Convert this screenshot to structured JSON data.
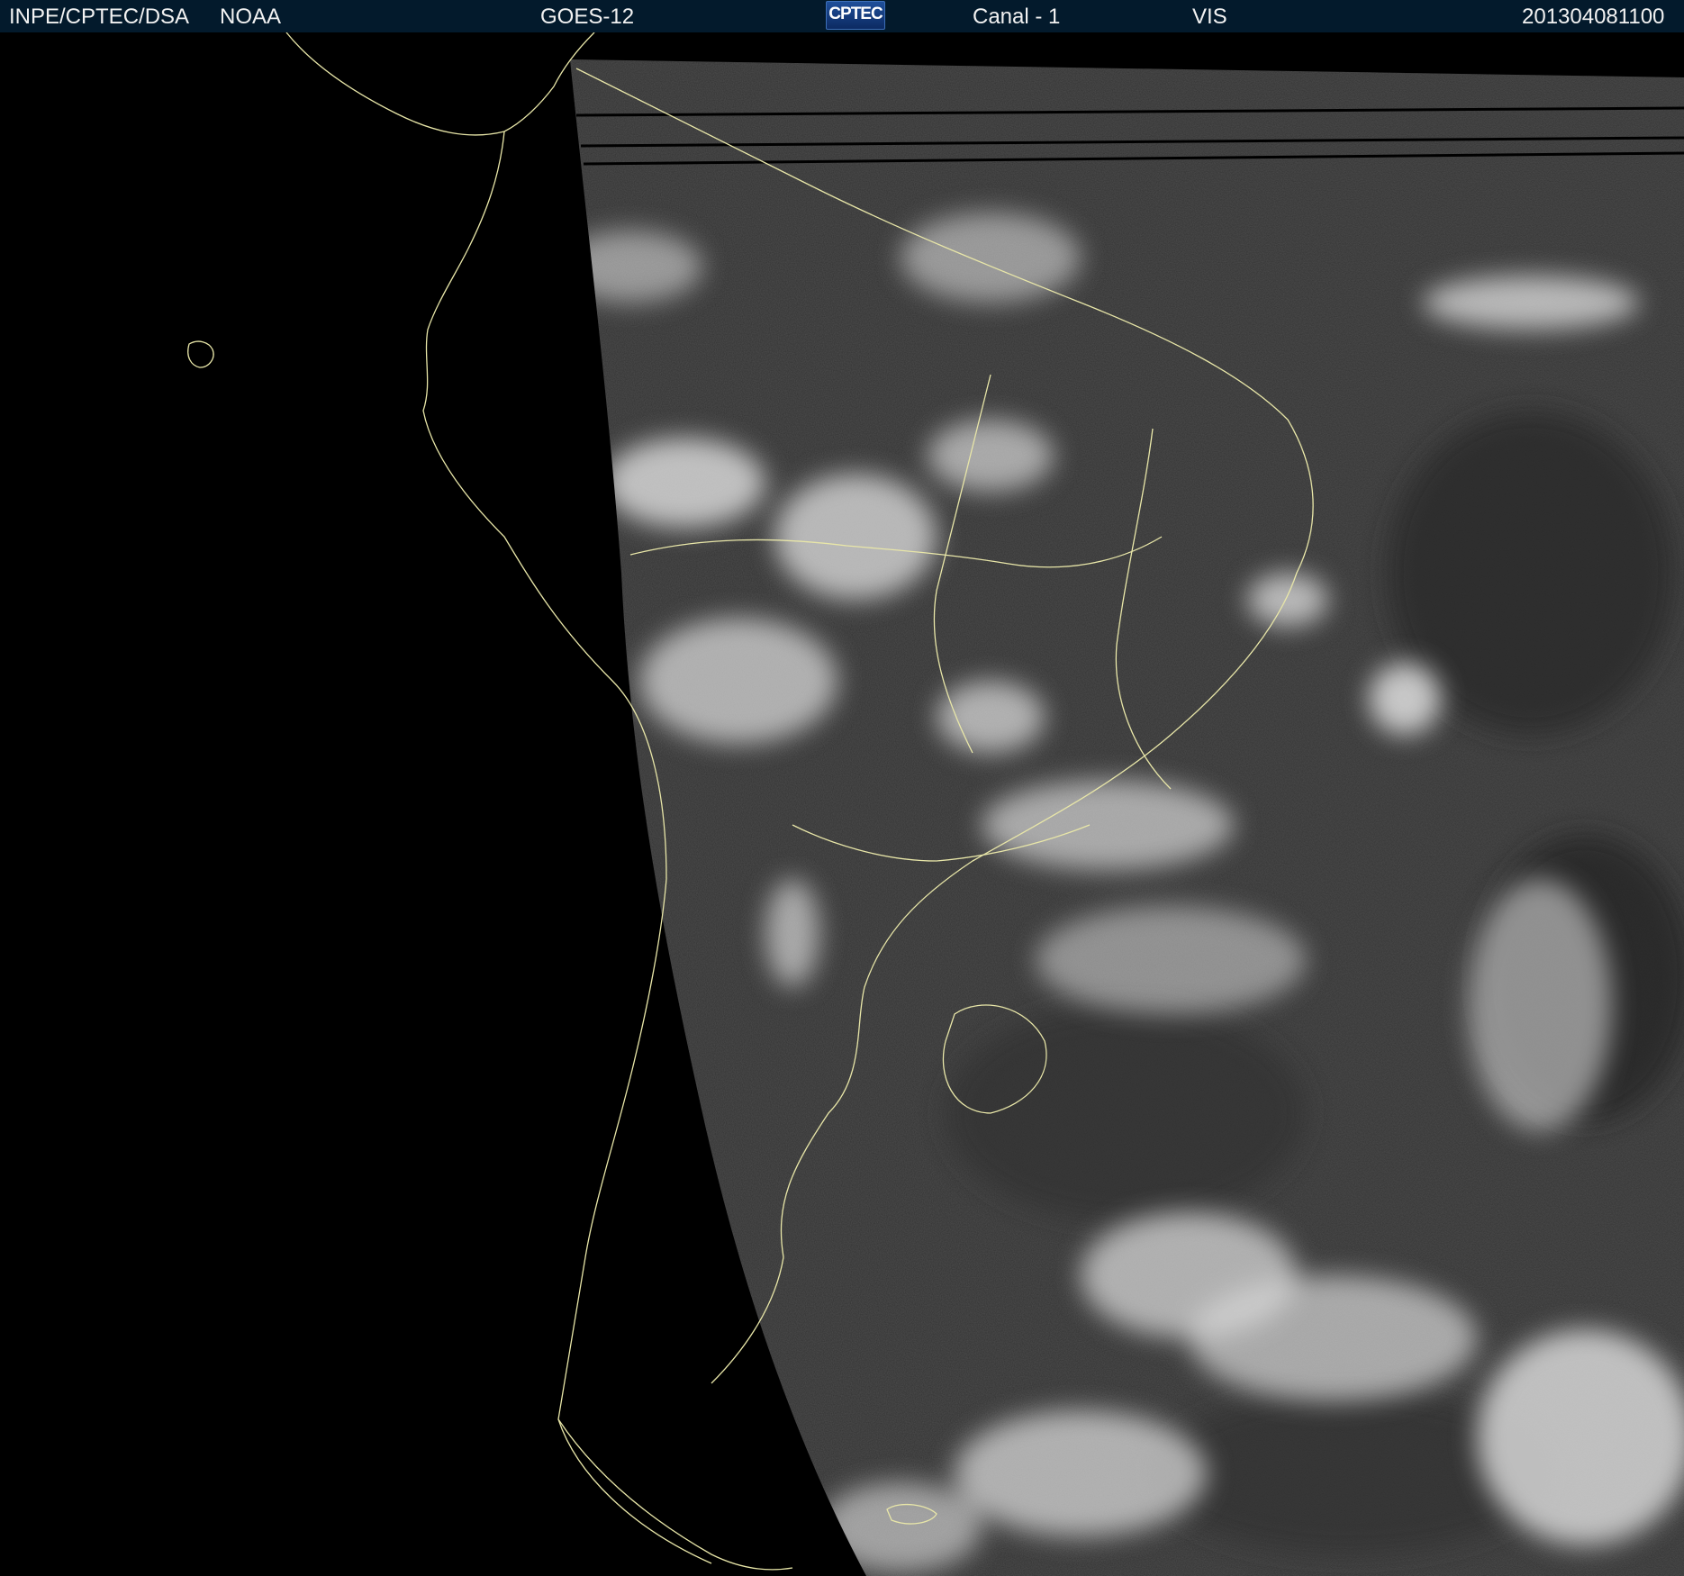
{
  "header": {
    "org": "INPE/CPTEC/DSA",
    "agency": "NOAA",
    "satellite": "GOES-12",
    "logo_text": "CPTEC",
    "channel": "Canal - 1",
    "band": "VIS",
    "timestamp": "201304081100"
  },
  "colors": {
    "header_bg": "#031a2c",
    "background": "#000000",
    "coastline": "#e8e6a8",
    "cloud_bright": "#d8d8d8",
    "surface_gray": "#555555"
  },
  "map": {
    "content": "GOES-12 visible channel satellite image of South America with coastline and country borders"
  }
}
